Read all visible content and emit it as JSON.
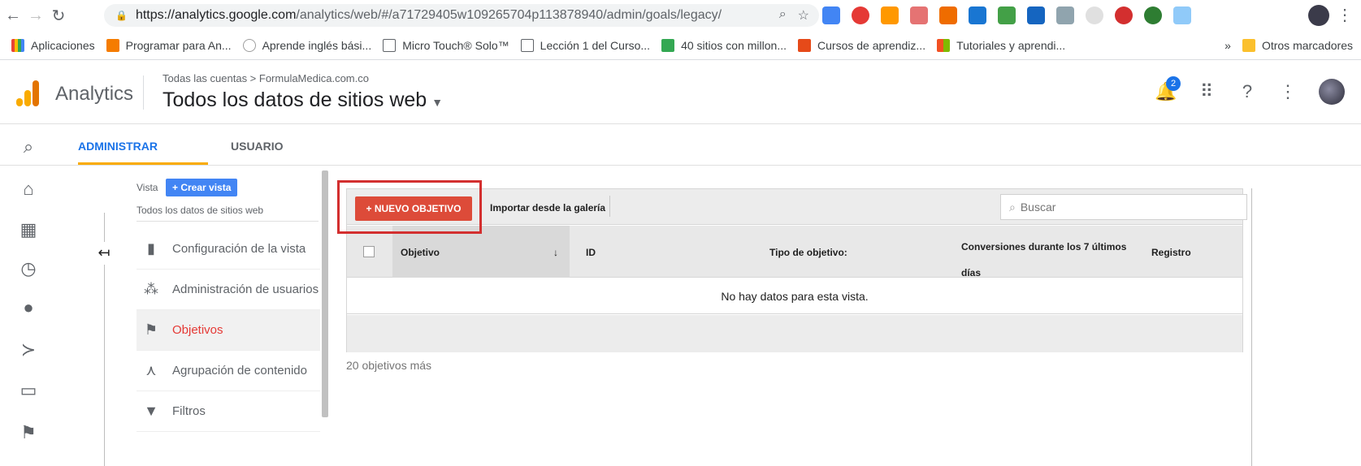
{
  "browser": {
    "url_host": "https://analytics.google.com",
    "url_path": "/analytics/web/#/a71729405w109265704p113878940/admin/goals/legacy/",
    "bookmarks": [
      {
        "label": "Aplicaciones",
        "color": "#ea4335"
      },
      {
        "label": "Programar para An...",
        "color": "#f57c00"
      },
      {
        "label": "Aprende inglés bási...",
        "color": "#9e9e9e"
      },
      {
        "label": "Micro Touch® Solo™",
        "color": "#ffffff"
      },
      {
        "label": "Lección 1 del Curso...",
        "color": "#ffffff"
      },
      {
        "label": "40 sitios con millon...",
        "color": "#34a853"
      },
      {
        "label": "Cursos de aprendiz...",
        "color": "#e64a19"
      },
      {
        "label": "Tutoriales y aprendi...",
        "color": "#4285f4"
      }
    ],
    "bookmarks_overflow": "»",
    "other_bookmarks": "Otros marcadores"
  },
  "header": {
    "product": "Analytics",
    "breadcrumb": "Todas las cuentas > FormulaMedica.com.co",
    "account": "Todos los datos de sitios web",
    "notifications": "2"
  },
  "tabs": {
    "admin": "ADMINISTRAR",
    "user": "USUARIO"
  },
  "view": {
    "label": "Vista",
    "create_button": "+ Crear vista",
    "name": "Todos los datos de sitios web"
  },
  "menu": [
    {
      "label": "Configuración de la vista",
      "icon": "document-icon"
    },
    {
      "label": "Administración de usuarios",
      "icon": "users-icon"
    },
    {
      "label": "Objetivos",
      "icon": "flag-icon"
    },
    {
      "label": "Agrupación de contenido",
      "icon": "content-group-icon"
    },
    {
      "label": "Filtros",
      "icon": "filter-icon"
    }
  ],
  "goals": {
    "new_button": "+ NUEVO OBJETIVO",
    "import_link": "Importar desde la galería",
    "search_placeholder": "Buscar",
    "columns": {
      "objective": "Objetivo",
      "id": "ID",
      "type": "Tipo de objetivo:",
      "conversions": "Conversiones durante los 7 últimos días",
      "record": "Registro"
    },
    "no_data": "No hay datos para esta vista.",
    "more": "20 objetivos más"
  },
  "colors": {
    "accent": "#1a73e8",
    "new_button": "#dd4b39",
    "highlight": "#d32f2f",
    "active_menu": "#e53935"
  }
}
